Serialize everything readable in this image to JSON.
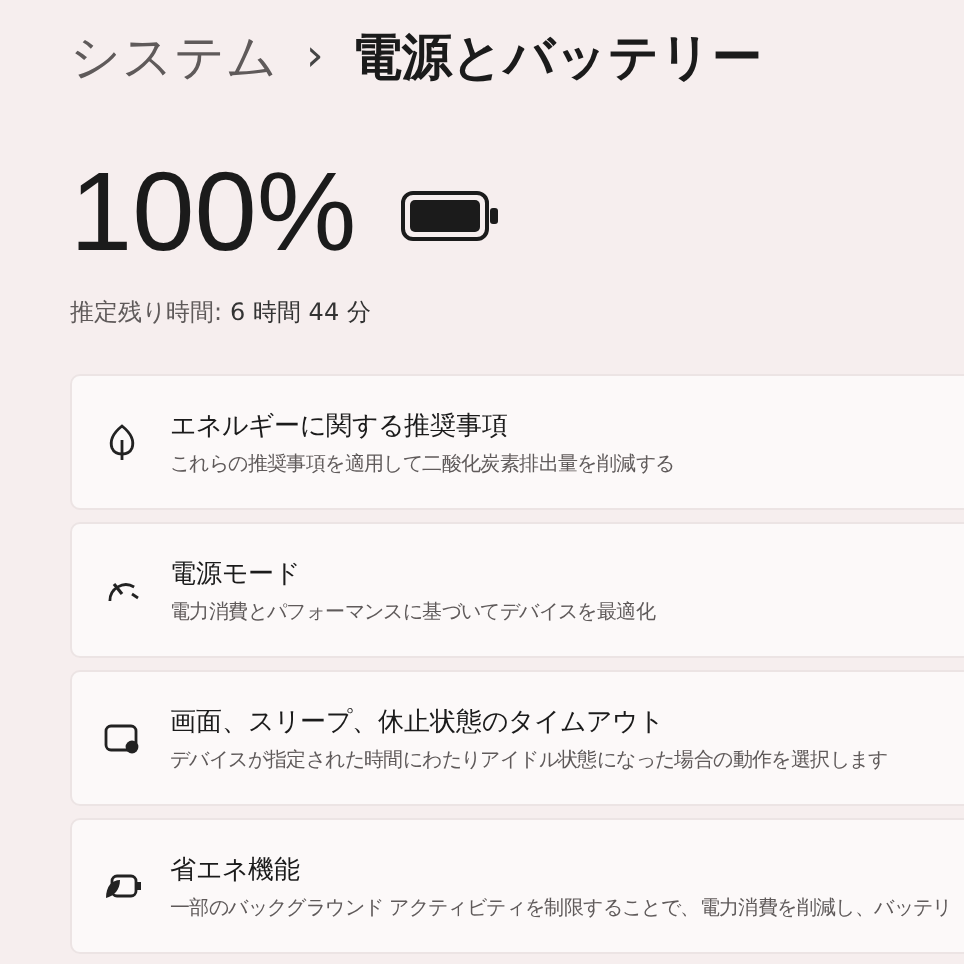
{
  "breadcrumb": {
    "parent": "システム",
    "separator": "›",
    "current": "電源とバッテリー"
  },
  "battery": {
    "percent": "100%",
    "estimate_label": "推定残り時間:",
    "estimate_value": "6 時間 44 分"
  },
  "settings": [
    {
      "title": "エネルギーに関する推奨事項",
      "description": "これらの推奨事項を適用して二酸化炭素排出量を削減する"
    },
    {
      "title": "電源モード",
      "description": "電力消費とパフォーマンスに基づいてデバイスを最適化"
    },
    {
      "title": "画面、スリープ、休止状態のタイムアウト",
      "description": "デバイスが指定された時間にわたりアイドル状態になった場合の動作を選択します"
    },
    {
      "title": "省エネ機能",
      "description": "一部のバックグラウンド アクティビティを制限することで、電力消費を削減し、バッテリ"
    }
  ]
}
